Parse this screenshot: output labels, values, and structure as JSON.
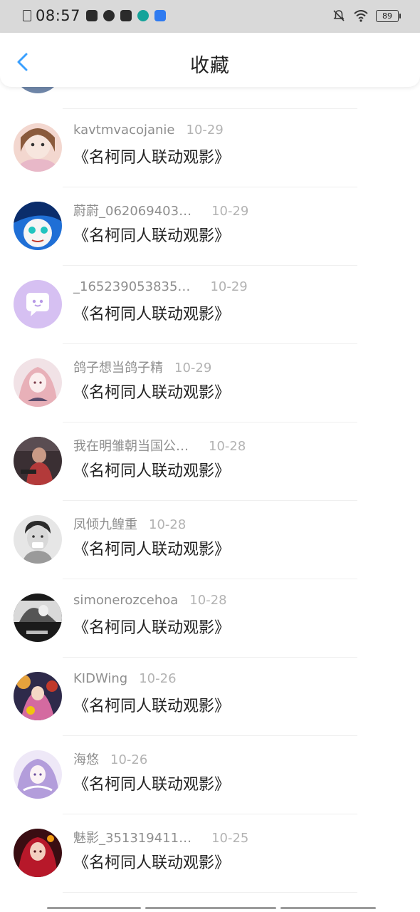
{
  "status_bar": {
    "time": "08:57",
    "battery": "89"
  },
  "header": {
    "title": "收藏"
  },
  "colors": {
    "accent": "#3aa0ff",
    "username": "#8e8e8e",
    "date": "#b3b3b3",
    "status_bg": "#d9d9d9"
  },
  "list": {
    "items": [
      {
        "user": "kavtmvacojanie",
        "date": "10-29",
        "title": "《名柯同人联动观影》",
        "avatar_icon": "girl-portrait-avatar"
      },
      {
        "user": "蔚蔚_062069403…",
        "date": "10-29",
        "title": "《名柯同人联动观影》",
        "avatar_icon": "anime-character-avatar"
      },
      {
        "user": "_165239053835…",
        "date": "10-29",
        "title": "《名柯同人联动观影》",
        "avatar_icon": "default-chat-bubble-avatar"
      },
      {
        "user": "鸽子想当鸽子精",
        "date": "10-29",
        "title": "《名柯同人联动观影》",
        "avatar_icon": "anime-girl-avatar"
      },
      {
        "user": "我在明雏朝当国公…",
        "date": "10-28",
        "title": "《名柯同人联动观影》",
        "avatar_icon": "photo-avatar"
      },
      {
        "user": "凤倾九鳇重",
        "date": "10-28",
        "title": "《名柯同人联动观影》",
        "avatar_icon": "man-portrait-avatar"
      },
      {
        "user": "simonerozcehoa",
        "date": "10-28",
        "title": "《名柯同人联动观影》",
        "avatar_icon": "bw-photo-avatar"
      },
      {
        "user": "KIDWing",
        "date": "10-26",
        "title": "《名柯同人联动观影》",
        "avatar_icon": "colorful-anime-avatar"
      },
      {
        "user": "海悠",
        "date": "10-26",
        "title": "《名柯同人联动观影》",
        "avatar_icon": "purple-anime-avatar"
      },
      {
        "user": "魅影_351319411…",
        "date": "10-25",
        "title": "《名柯同人联动观影》",
        "avatar_icon": "red-anime-avatar"
      }
    ]
  }
}
